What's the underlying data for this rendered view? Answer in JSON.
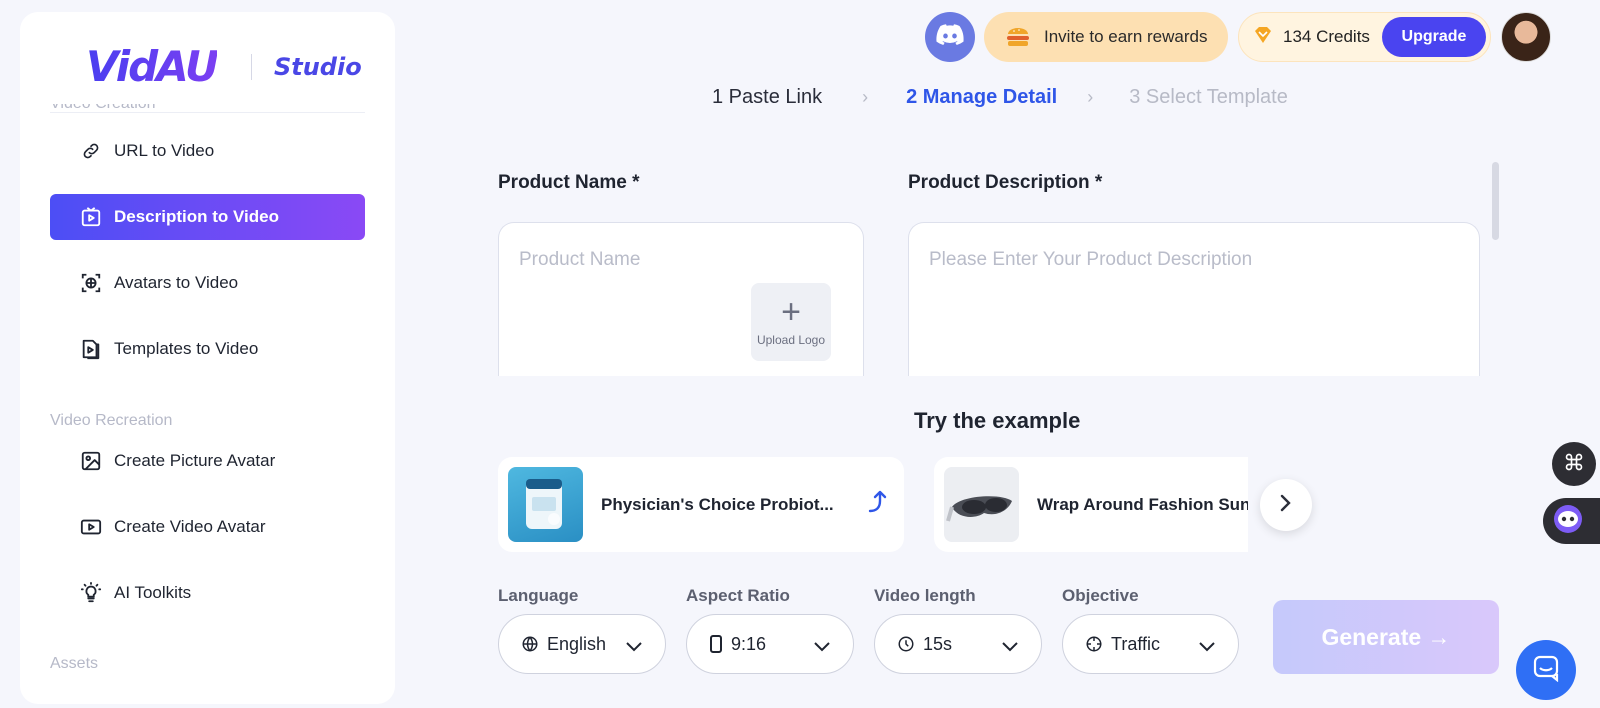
{
  "brand": {
    "name": "VidAU",
    "product": "Studio"
  },
  "sidebar": {
    "cut_heading": "Video Creation",
    "items": [
      {
        "label": "URL to Video",
        "icon": "link-icon"
      },
      {
        "label": "Description to Video",
        "icon": "video-description-icon",
        "active": true
      },
      {
        "label": "Avatars to Video",
        "icon": "avatar-scan-icon"
      },
      {
        "label": "Templates to Video",
        "icon": "template-icon"
      }
    ],
    "recreation_label": "Video Recreation",
    "recreation_items": [
      {
        "label": "Create Picture Avatar",
        "icon": "image-icon"
      },
      {
        "label": "Create Video Avatar",
        "icon": "play-box-icon"
      },
      {
        "label": "AI Toolkits",
        "icon": "lightbulb-icon"
      }
    ],
    "assets_label": "Assets"
  },
  "topbar": {
    "invite_label": "Invite to earn rewards",
    "credits_label": "134 Credits",
    "upgrade_label": "Upgrade"
  },
  "steps": [
    {
      "label": "1 Paste Link",
      "state": "done"
    },
    {
      "label": "2 Manage Detail",
      "state": "active"
    },
    {
      "label": "3 Select Template",
      "state": "pending"
    }
  ],
  "form": {
    "product_name_label": "Product Name *",
    "product_name_placeholder": "Product Name",
    "upload_logo_label": "Upload Logo",
    "product_description_label": "Product Description *",
    "product_description_placeholder": "Please Enter Your Product Description"
  },
  "examples": {
    "title": "Try the example",
    "items": [
      {
        "title": "Physician's Choice Probiot..."
      },
      {
        "title": "Wrap Around Fashion Sunglasses"
      }
    ]
  },
  "options": {
    "language_label": "Language",
    "language_value": "English",
    "aspect_label": "Aspect Ratio",
    "aspect_value": "9:16",
    "length_label": "Video length",
    "length_value": "15s",
    "objective_label": "Objective",
    "objective_value": "Traffic"
  },
  "generate_label": "Generate →",
  "colors": {
    "accent": "#4a44f0",
    "active_step": "#2f56e8",
    "invite_bg": "#fde0b2"
  }
}
